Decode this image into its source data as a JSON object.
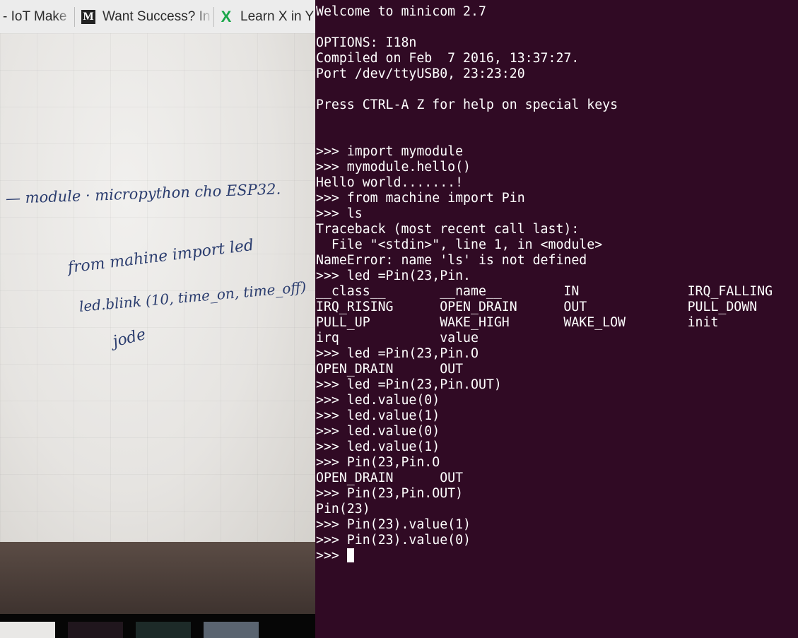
{
  "browser": {
    "tabs": [
      {
        "label": "- IoT Make",
        "icon": "none"
      },
      {
        "label": "Want Success? In",
        "icon": "medium-m-icon"
      },
      {
        "label": "Learn X in Y",
        "icon": "learnxiny-x-icon"
      }
    ],
    "whiteboard_text": [
      "— module · micropython cho ESP32.",
      "from mahine import led",
      "led.blink (10, time_on, time_off)",
      "jode"
    ]
  },
  "terminal": {
    "background": "#300a24",
    "lines": [
      "Welcome to minicom 2.7",
      "",
      "OPTIONS: I18n",
      "Compiled on Feb  7 2016, 13:37:27.",
      "Port /dev/ttyUSB0, 23:23:20",
      "",
      "Press CTRL-A Z for help on special keys",
      "",
      "",
      ">>> import mymodule",
      ">>> mymodule.hello()",
      "Hello world.......!",
      ">>> from machine import Pin",
      ">>> ls",
      "Traceback (most recent call last):",
      "  File \"<stdin>\", line 1, in <module>",
      "NameError: name 'ls' is not defined",
      ">>> led =Pin(23,Pin.",
      "__class__       __name__        IN              IRQ_FALLING",
      "IRQ_RISING      OPEN_DRAIN      OUT             PULL_DOWN",
      "PULL_UP         WAKE_HIGH       WAKE_LOW        init",
      "irq             value",
      ">>> led =Pin(23,Pin.O",
      "OPEN_DRAIN      OUT",
      ">>> led =Pin(23,Pin.OUT)",
      ">>> led.value(0)",
      ">>> led.value(1)",
      ">>> led.value(0)",
      ">>> led.value(1)",
      ">>> Pin(23,Pin.O",
      "OPEN_DRAIN      OUT",
      ">>> Pin(23,Pin.OUT)",
      "Pin(23)",
      ">>> Pin(23).value(1)",
      ">>> Pin(23).value(0)"
    ],
    "prompt": ">>> "
  }
}
